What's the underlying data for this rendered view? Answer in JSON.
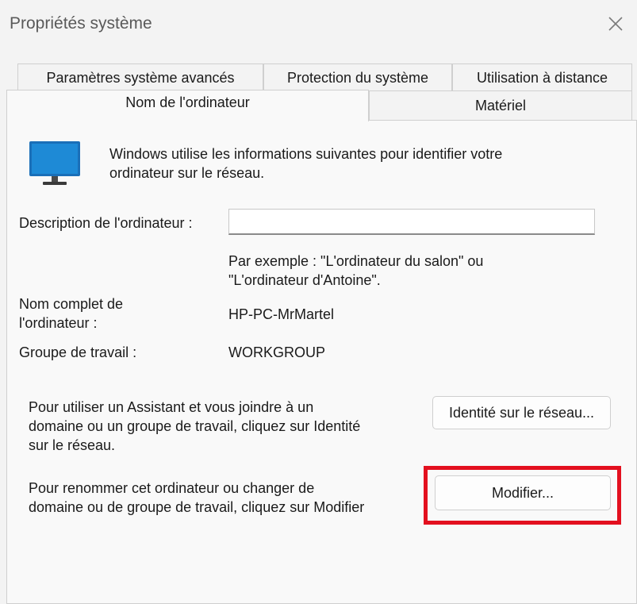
{
  "window": {
    "title": "Propriétés système",
    "close_icon": "close-icon"
  },
  "tabs": {
    "row_back": [
      "Paramètres système avancés",
      "Protection du système",
      "Utilisation à distance"
    ],
    "row_front": [
      "Nom de l'ordinateur",
      "Matériel"
    ],
    "active": "Nom de l'ordinateur"
  },
  "computer_name": {
    "icon": "monitor-icon",
    "intro_lines": [
      "Windows utilise les informations suivantes pour identifier votre",
      "ordinateur sur le réseau."
    ],
    "description_label": "Description de l'ordinateur :",
    "description_value": "",
    "example_lines": [
      "Par exemple : \"L'ordinateur du salon\" ou",
      "\"L'ordinateur d'Antoine\"."
    ],
    "full_name_label_lines": [
      "Nom complet de",
      "l'ordinateur :"
    ],
    "full_name_value": "HP-PC-MrMartel",
    "workgroup_label": "Groupe de travail :",
    "workgroup_value": "WORKGROUP",
    "network_id_text_lines": [
      "Pour utiliser un Assistant et vous joindre à un",
      "domaine ou un groupe de travail, cliquez sur Identité",
      "sur le réseau."
    ],
    "network_id_button": "Identité sur le réseau...",
    "rename_text_lines": [
      "Pour renommer cet ordinateur ou changer de",
      "domaine ou de groupe de travail, cliquez sur Modifier"
    ],
    "modify_button": "Modifier..."
  },
  "colors": {
    "highlight": "#e3101f",
    "monitor_blue": "#1e8ad6"
  }
}
